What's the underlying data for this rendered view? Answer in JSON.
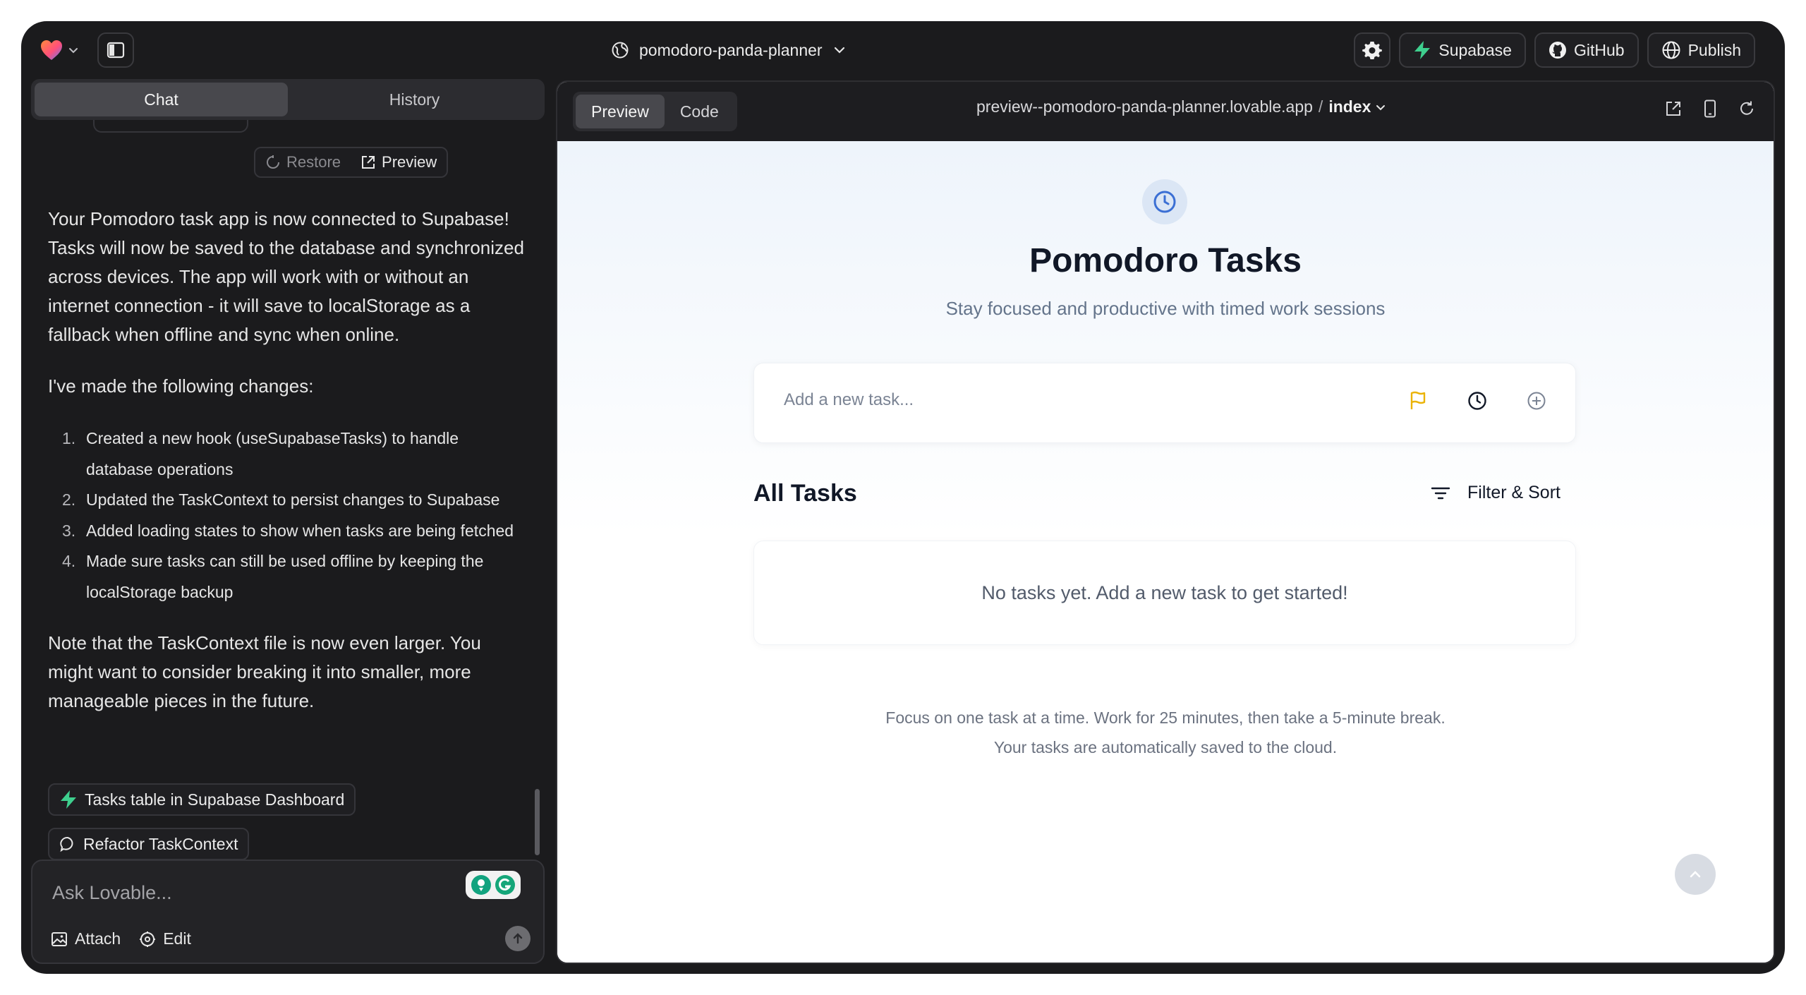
{
  "topbar": {
    "project_name": "pomodoro-panda-planner",
    "supabase_label": "Supabase",
    "github_label": "GitHub",
    "publish_label": "Publish"
  },
  "chat_panel": {
    "tabs": [
      {
        "label": "Chat",
        "active": true
      },
      {
        "label": "History",
        "active": false
      }
    ],
    "message_actions": {
      "restore_label": "Restore",
      "preview_label": "Preview"
    },
    "message": {
      "paragraph1": "Your Pomodoro task app is now connected to Supabase! Tasks will now be saved to the database and synchronized across devices. The app will work with or without an internet connection - it will save to localStorage as a fallback when offline and sync when online.",
      "paragraph2": "I've made the following changes:",
      "changes": [
        {
          "num": "1.",
          "text": "Created a new hook (useSupabaseTasks) to handle database operations"
        },
        {
          "num": "2.",
          "text": "Updated the TaskContext to persist changes to Supabase"
        },
        {
          "num": "3.",
          "text": "Added loading states to show when tasks are being fetched"
        },
        {
          "num": "4.",
          "text": "Made sure tasks can still be used offline by keeping the localStorage backup"
        }
      ],
      "paragraph3": "Note that the TaskContext file is now even larger. You might want to consider breaking it into smaller, more manageable pieces in the future."
    },
    "suggestions": [
      {
        "label": "Tasks table in Supabase Dashboard",
        "icon": "supabase-bolt-icon"
      },
      {
        "label": "Refactor TaskContext",
        "icon": "chat-bubble-icon"
      }
    ],
    "composer": {
      "placeholder": "Ask Lovable...",
      "attach_label": "Attach",
      "edit_label": "Edit"
    }
  },
  "preview_panel": {
    "tabs": [
      {
        "label": "Preview",
        "active": true
      },
      {
        "label": "Code",
        "active": false
      }
    ],
    "url": {
      "host": "preview--pomodoro-panda-planner.lovable.app",
      "separator": "/",
      "page": "index"
    }
  },
  "site": {
    "title": "Pomodoro Tasks",
    "subtitle": "Stay focused and productive with timed work sessions",
    "task_input_placeholder": "Add a new task...",
    "section_title": "All Tasks",
    "filter_label": "Filter & Sort",
    "empty_state": "No tasks yet. Add a new task to get started!",
    "footer_line1": "Focus on one task at a time. Work for 25 minutes, then take a 5-minute break.",
    "footer_line2": "Your tasks are automatically saved to the cloud."
  },
  "colors": {
    "app_background": "#1b1b1d",
    "supabase_green": "#3ecf8e",
    "flag_yellow": "#eab308",
    "logo_blue": "#3b6fd4"
  }
}
